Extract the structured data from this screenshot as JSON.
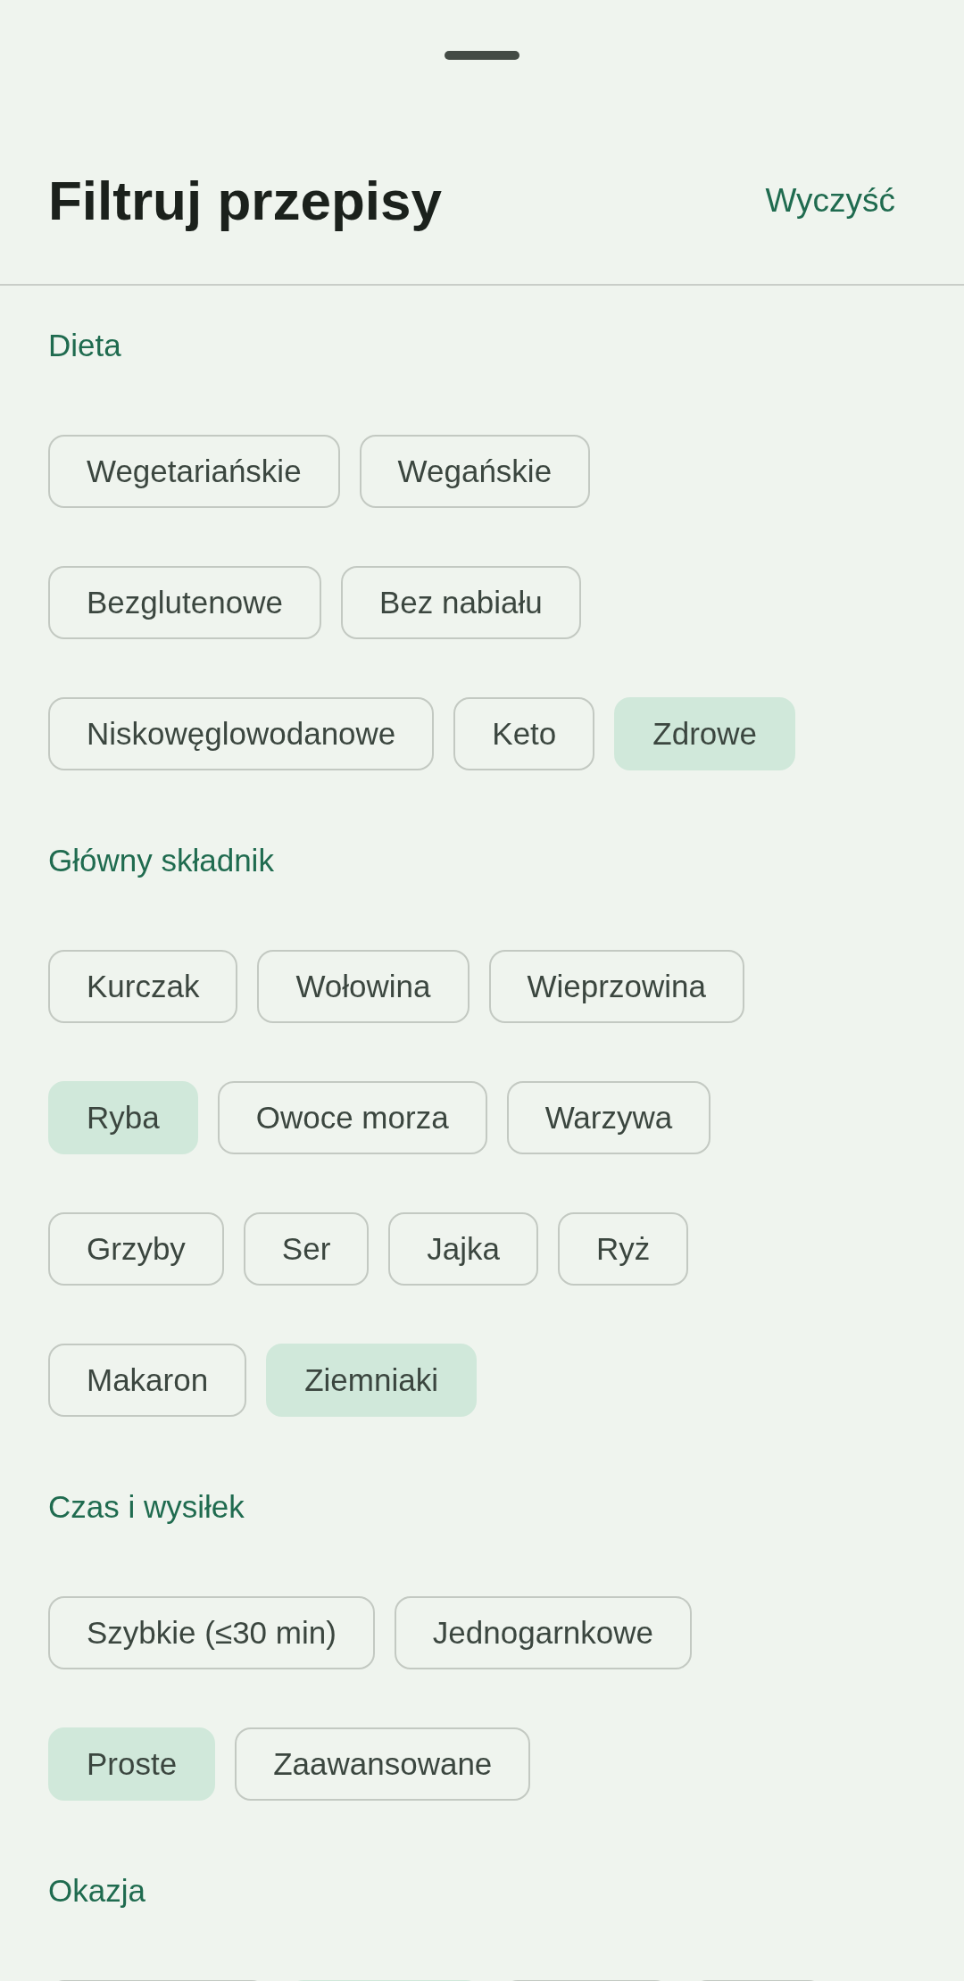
{
  "header": {
    "title": "Filtruj przepisy",
    "clear_button": "Wyczyść"
  },
  "sections": [
    {
      "title": "Dieta",
      "rows": [
        [
          {
            "label": "Wegetariańskie",
            "selected": false
          },
          {
            "label": "Wegańskie",
            "selected": false
          }
        ],
        [
          {
            "label": "Bezglutenowe",
            "selected": false
          },
          {
            "label": "Bez nabiału",
            "selected": false
          }
        ],
        [
          {
            "label": "Niskowęglowodanowe",
            "selected": false
          },
          {
            "label": "Keto",
            "selected": false
          },
          {
            "label": "Zdrowe",
            "selected": true
          }
        ]
      ]
    },
    {
      "title": "Główny składnik",
      "rows": [
        [
          {
            "label": "Kurczak",
            "selected": false
          },
          {
            "label": "Wołowina",
            "selected": false
          },
          {
            "label": "Wieprzowina",
            "selected": false
          }
        ],
        [
          {
            "label": "Ryba",
            "selected": true
          },
          {
            "label": "Owoce morza",
            "selected": false
          },
          {
            "label": "Warzywa",
            "selected": false
          }
        ],
        [
          {
            "label": "Grzyby",
            "selected": false
          },
          {
            "label": "Ser",
            "selected": false
          },
          {
            "label": "Jajka",
            "selected": false
          },
          {
            "label": "Ryż",
            "selected": false
          }
        ],
        [
          {
            "label": "Makaron",
            "selected": false
          },
          {
            "label": "Ziemniaki",
            "selected": true
          }
        ]
      ]
    },
    {
      "title": "Czas i wysiłek",
      "rows": [
        [
          {
            "label": "Szybkie (≤30 min)",
            "selected": false
          },
          {
            "label": "Jednogarnkowe",
            "selected": false
          }
        ],
        [
          {
            "label": "Proste",
            "selected": true
          },
          {
            "label": "Zaawansowane",
            "selected": false
          }
        ]
      ]
    },
    {
      "title": "Okazja",
      "rows": [
        [
          {
            "selected": false
          },
          {
            "selected": true
          },
          {
            "selected": false
          },
          {
            "selected": false
          }
        ]
      ]
    }
  ]
}
